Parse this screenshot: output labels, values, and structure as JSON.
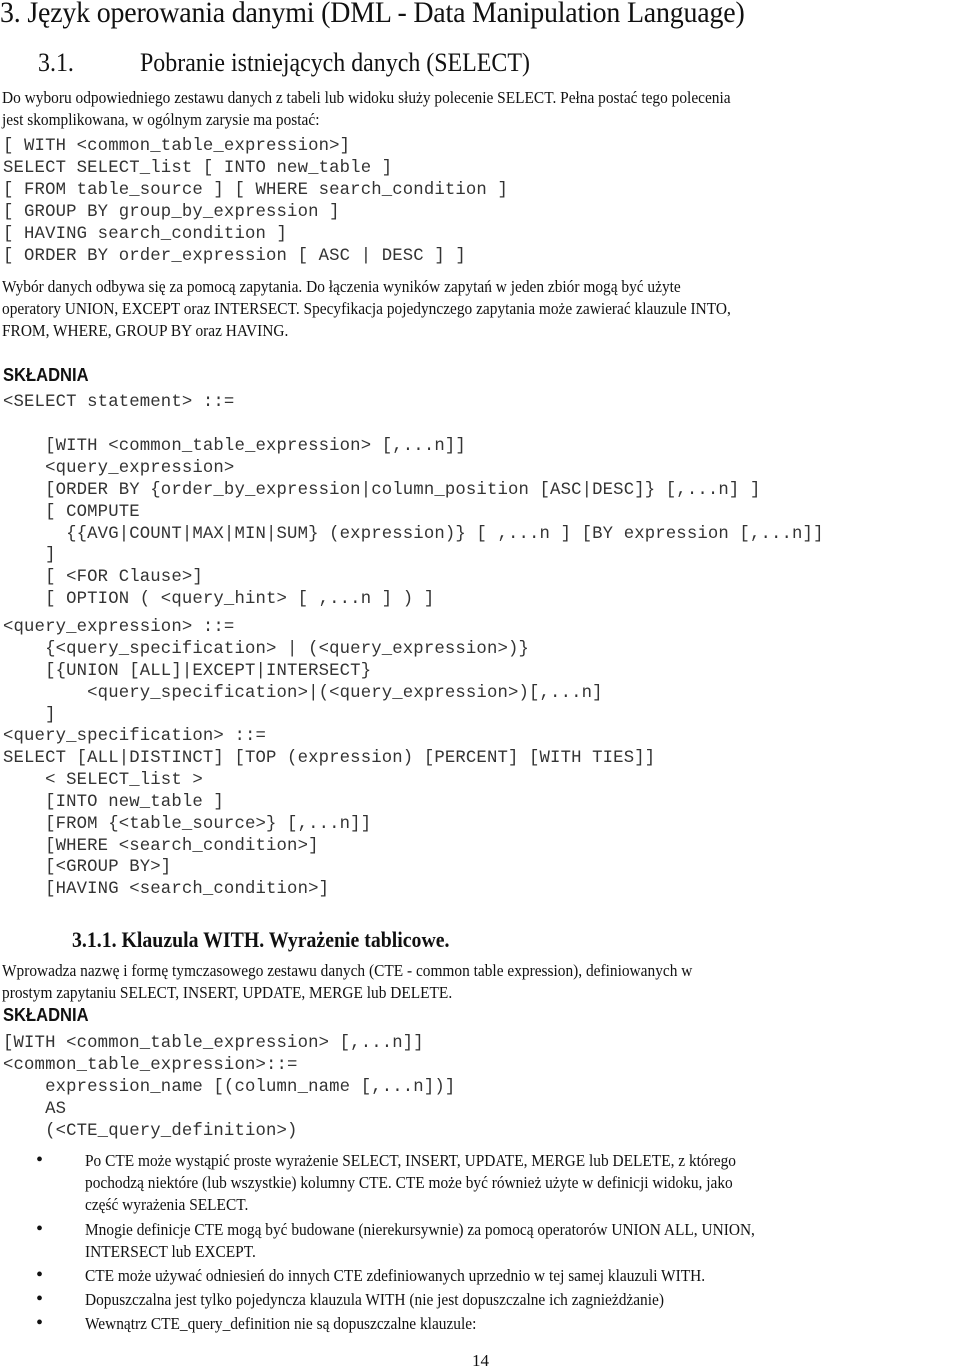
{
  "chapter_heading": "3. Język operowania danymi (DML - Data Manipulation Language)",
  "section": {
    "number": "3.1.",
    "title": "Pobranie istniejących danych (SELECT)"
  },
  "intro_paragraph": [
    "Do wyboru odpowiedniego zestawu danych z tabeli lub widoku służy polecenie SELECT. Pełna postać tego polecenia",
    "jest skomplikowana, w ogólnym zarysie ma postać:"
  ],
  "general_form_code": [
    "[ WITH <common_table_expression>]",
    "SELECT SELECT_list [ INTO new_table ]",
    "[ FROM table_source ] [ WHERE search_condition ]",
    "[ GROUP BY group_by_expression ]",
    "[ HAVING search_condition ]",
    "[ ORDER BY order_expression [ ASC | DESC ] ]"
  ],
  "description_paragraph": [
    "Wybór danych odbywa się za pomocą zapytania. Do łączenia wyników zapytań w jeden zbiór mogą być użyte",
    "operatory UNION, EXCEPT oraz INTERSECT. Specyfikacja pojedynczego zapytania może zawierać klauzule INTO,",
    "FROM, WHERE, GROUP BY oraz HAVING."
  ],
  "syntax_label": "SKŁADNIA",
  "syntax_code": [
    "<SELECT statement> ::=",
    "",
    "    [WITH <common_table_expression> [,...n]]",
    "    <query_expression>",
    "    [ORDER BY {order_by_expression|column_position [ASC|DESC]} [,...n] ]",
    "    [ COMPUTE",
    "      {{AVG|COUNT|MAX|MIN|SUM} (expression)} [ ,...n ] [BY expression [,...n]]",
    "    ]",
    "    [ <FOR Clause>]",
    "    [ OPTION ( <query_hint> [ ,...n ] ) ]",
    "<query_expression> ::=",
    "    {<query_specification> | (<query_expression>)}",
    "    [{UNION [ALL]|EXCEPT|INTERSECT}",
    "        <query_specification>|(<query_expression>)[,...n]",
    "    ]",
    "<query_specification> ::=",
    "SELECT [ALL|DISTINCT] [TOP (expression) [PERCENT] [WITH TIES]]",
    "    < SELECT_list >",
    "    [INTO new_table ]",
    "    [FROM {<table_source>} [,...n]]",
    "    [WHERE <search_condition>]",
    "    [<GROUP BY>]",
    "    [HAVING <search_condition>]"
  ],
  "subsection": {
    "title": "3.1.1. Klauzula WITH. Wyrażenie tablicowe.",
    "paragraph": [
      "Wprowadza nazwę i formę tymczasowego zestawu danych (CTE - common table expression), definiowanych w",
      "prostym zapytaniu SELECT, INSERT, UPDATE, MERGE lub DELETE."
    ],
    "syntax_label": "SKŁADNIA",
    "syntax_code": [
      "[WITH <common_table_expression> [,...n]]",
      "<common_table_expression>::=",
      "    expression_name [(column_name [,...n])]",
      "    AS",
      "    (<CTE_query_definition>)"
    ],
    "bullets": [
      [
        "Po CTE może wystąpić proste wyrażenie SELECT, INSERT, UPDATE, MERGE lub DELETE, z którego",
        "pochodzą niektóre (lub wszystkie) kolumny CTE. CTE może być również użyte w definicji widoku, jako",
        "część wyrażenia SELECT."
      ],
      [
        "Mnogie definicje CTE mogą być budowane (nierekursywnie) za pomocą operatorów UNION ALL, UNION,",
        "INTERSECT lub EXCEPT."
      ],
      [
        "CTE może używać odniesień do innych CTE zdefiniowanych uprzednio w tej samej klauzuli WITH."
      ],
      [
        "Dopuszczalna jest tylko pojedyncza klauzula WITH (nie jest dopuszczalne ich zagnieżdżanie)"
      ],
      [
        "Wewnątrz CTE_query_definition nie są dopuszczalne klauzule:"
      ]
    ]
  },
  "page_number": "14"
}
